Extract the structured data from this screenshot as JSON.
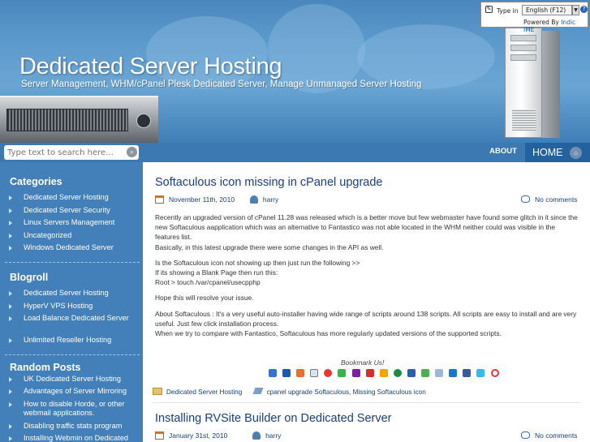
{
  "header": {
    "title": "Dedicated Server Hosting",
    "tagline": "Server Management, WHM/cPanel Plesk Dedicated Server, Manage Unmanaged Server Hosting"
  },
  "ime": {
    "type_in": "Type in",
    "language": "English (F12)",
    "help": "?",
    "powered_by": "Powered By",
    "powered_link": "Indic IME"
  },
  "search": {
    "placeholder": "Type text to search here..."
  },
  "nav": {
    "about": "ABOUT",
    "home": "HOME"
  },
  "sidebar": {
    "categories_title": "Categories",
    "categories": [
      "Dedicated Server Hosting",
      "Dedicated Server Security",
      "Linux Servers Management",
      "Uncategorized",
      "Windows Dedicated Server"
    ],
    "blogroll_title": "Blogroll",
    "blogroll": [
      "Dedicated Server Hosting",
      "HyperV VPS Hosting",
      "Load Balance Dedicated Server",
      "Unlimited Reseller Hosting"
    ],
    "random_title": "Random Posts",
    "random": [
      "UK Dedicated Server Hosting",
      "Advantages of Server Mirroring",
      "How to disable Horde, or other webmail applications.",
      "Disabling traffic stats program",
      "Installing Webmin on Dedicated"
    ]
  },
  "posts": [
    {
      "title": "Softaculous icon missing in cPanel upgrade",
      "date": "November 11th, 2010",
      "author": "harry",
      "comments": "No comments",
      "paragraphs": [
        "Recently an upgraded version of cPanel 11.28 was released which is a better move but few webmaster have found some glitch in it since the new Softaculous aapplication which was an alternative to Fantastico was not able located in the WHM neither could was visible in the features list.",
        "Basically, in this latest upgrade there were some changes in the API as well.",
        "Is the Softaculous icon not showing up then just run the following >>",
        "If its showing a Blank Page then run this:",
        "Root > touch /var/cpanel/usecpphp",
        "Hope this will resolve your issue.",
        "About Softaculous : It's a very useful auto-installer having wide range of scripts around 138 scripts. All scripts are easy to install and are very useful. Just few click installation process.",
        "When we try to compare with Fantastico, Softaculous has more regularly updated versions of the supported scripts."
      ],
      "bookmark_label": "Bookmark Us!",
      "category": "Dedicated Server Hosting",
      "tags": "cpanel upgrade Softaculous, Missing Softaculous icon"
    },
    {
      "title": "Installing RVSite Builder on Dedicated Server",
      "date": "January 31st, 2010",
      "author": "harry",
      "comments": "No comments"
    }
  ],
  "colors": {
    "accent_blue": "#437fb8",
    "nav_active": "#24629f",
    "title_blue": "#1a3f7c"
  },
  "icons": {
    "bookmark_icons": [
      "delicious-icon",
      "digg-icon",
      "stumbleupon-icon",
      "reddit-icon",
      "google-icon",
      "technorati-icon",
      "yahoo-icon",
      "furl-icon",
      "ask-icon",
      "live-icon",
      "misterwong-icon",
      "newsvine-icon",
      "blinklist-icon",
      "magnolia-icon",
      "facebook-icon",
      "twitter-icon",
      "friendfeed-icon"
    ]
  }
}
